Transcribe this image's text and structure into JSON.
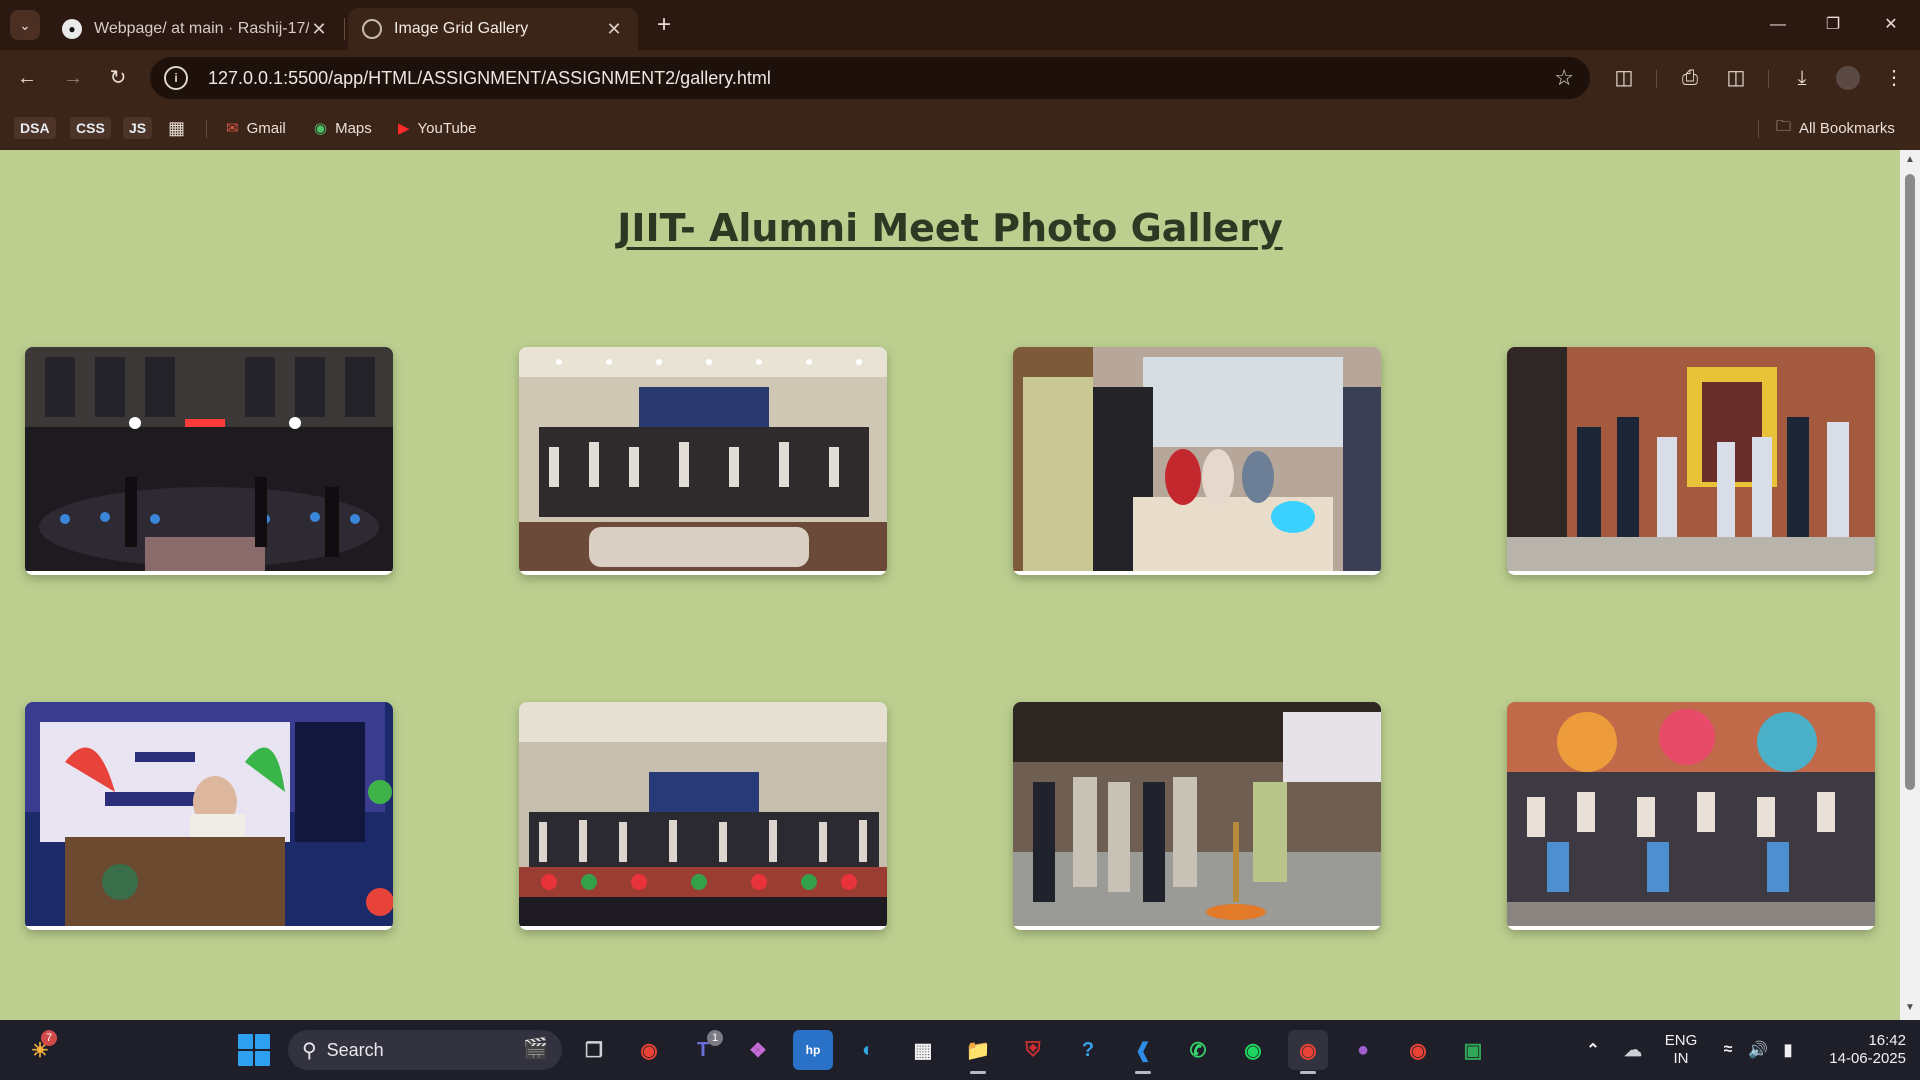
{
  "browser": {
    "tabs": [
      {
        "title": "Webpage/ at main · Rashij-17/\\",
        "favicon": "github-icon",
        "active": false
      },
      {
        "title": "Image Grid Gallery",
        "favicon": "globe-icon",
        "active": true
      }
    ],
    "url": "127.0.0.1:5500/app/HTML/ASSIGNMENT/ASSIGNMENT2/gallery.html",
    "bookmarks": [
      {
        "label": "DSA",
        "type": "chip"
      },
      {
        "label": "CSS",
        "type": "chip"
      },
      {
        "label": "JS",
        "type": "chip"
      },
      {
        "label": "Gmail",
        "icon": "gmail-icon"
      },
      {
        "label": "Maps",
        "icon": "maps-icon"
      },
      {
        "label": "YouTube",
        "icon": "youtube-icon"
      }
    ],
    "all_bookmarks": "All Bookmarks"
  },
  "page": {
    "title": "JIIT- Alumni Meet Photo Gallery",
    "images": [
      {
        "name": "photo-night-stage-performance"
      },
      {
        "name": "photo-auditorium-group"
      },
      {
        "name": "photo-exhibition-display"
      },
      {
        "name": "photo-campus-group"
      },
      {
        "name": "photo-speaker-podium"
      },
      {
        "name": "photo-auditorium-group-wide"
      },
      {
        "name": "photo-lamp-lighting-ceremony"
      },
      {
        "name": "photo-outdoor-group-mural"
      }
    ]
  },
  "taskbar": {
    "search_label": "Search",
    "teams_badge": "1",
    "widget_badge": "7",
    "language": "ENG",
    "region": "IN",
    "time": "16:42",
    "date": "14-06-2025"
  }
}
